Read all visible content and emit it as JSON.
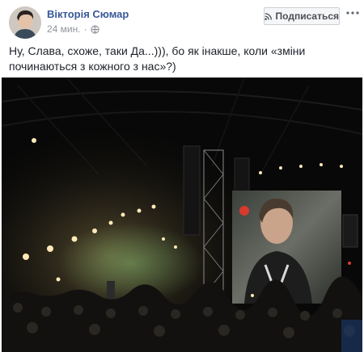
{
  "post": {
    "author_name": "Вікторія Сюмар",
    "time": "24 мин.",
    "privacy_icon": "globe-icon",
    "subscribe_label": "Подписаться",
    "subscribe_icon": "rss-feed-icon",
    "more_icon": "more-options-icon",
    "text": "Ну, Слава, схоже, таки Да...))), бо як інакше, коли «зміни починаються з кожного з нас»?)",
    "photo_description_icon": "concert-photo"
  },
  "colors": {
    "author_link": "#385898",
    "meta_gray": "#90949c",
    "button_bg": "#f5f6f7",
    "button_border": "#ced0d4"
  }
}
